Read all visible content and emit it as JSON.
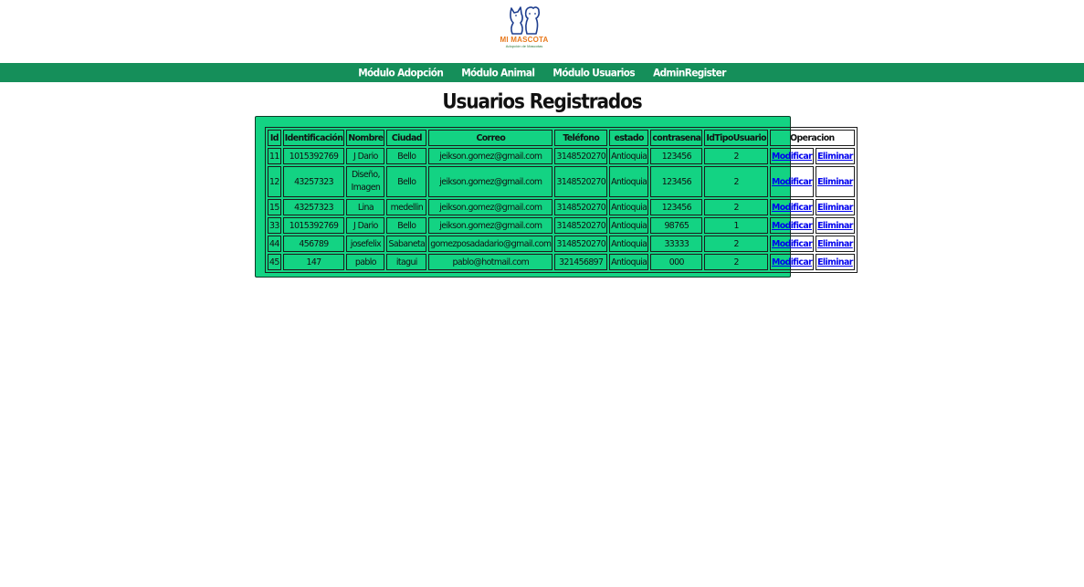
{
  "brand": {
    "name": "MI MASCOTA",
    "tagline": "Adopción de Mascotas"
  },
  "nav": {
    "items": [
      {
        "label": "Módulo Adopción"
      },
      {
        "label": "Módulo Animal"
      },
      {
        "label": "Módulo Usuarios"
      },
      {
        "label": "AdminRegister"
      }
    ]
  },
  "page": {
    "title": "Usuarios Registrados"
  },
  "table": {
    "headers": [
      "Id",
      "Identificación",
      "Nombre",
      "Ciudad",
      "Correo",
      "Teléfono",
      "estado",
      "contrasena",
      "IdTipoUsuario",
      "Operacion"
    ],
    "rows": [
      {
        "id": "11",
        "identificacion": "1015392769",
        "nombre": "J Dario",
        "ciudad": "Bello",
        "correo": "jeikson.gomez@gmail.com",
        "telefono": "3148520270",
        "estado": "Antioquia",
        "contrasena": "123456",
        "tipo": "2"
      },
      {
        "id": "12",
        "identificacion": "43257323",
        "nombre": "Diseño, Imagen",
        "ciudad": "Bello",
        "correo": "jeikson.gomez@gmail.com",
        "telefono": "3148520270",
        "estado": "Antioquia",
        "contrasena": "123456",
        "tipo": "2"
      },
      {
        "id": "15",
        "identificacion": "43257323",
        "nombre": "Lina",
        "ciudad": "medellin",
        "correo": "jeikson.gomez@gmail.com",
        "telefono": "3148520270",
        "estado": "Antioquia",
        "contrasena": "123456",
        "tipo": "2"
      },
      {
        "id": "33",
        "identificacion": "1015392769",
        "nombre": "J Dario",
        "ciudad": "Bello",
        "correo": "jeikson.gomez@gmail.com",
        "telefono": "3148520270",
        "estado": "Antioquia",
        "contrasena": "98765",
        "tipo": "1"
      },
      {
        "id": "44",
        "identificacion": "456789",
        "nombre": "josefelix",
        "ciudad": "Sabaneta",
        "correo": "gomezposadadario@gmail.com",
        "telefono": "3148520270",
        "estado": "Antioquia",
        "contrasena": "33333",
        "tipo": "2"
      },
      {
        "id": "45",
        "identificacion": "147",
        "nombre": "pablo",
        "ciudad": "itagui",
        "correo": "pablo@hotmail.com",
        "telefono": "321456897",
        "estado": "Antioquia",
        "contrasena": "000",
        "tipo": "2"
      }
    ],
    "actions": {
      "modify_label": "Modificar",
      "delete_label": "Eliminar"
    }
  },
  "colors": {
    "nav_bg": "#158f5a",
    "panel_bg": "#13d383",
    "link": "#0000ee",
    "brand_orange": "#e8791d",
    "brand_blue": "#1f3f8f"
  },
  "icons": {
    "logo": "cat-and-dog-logo-icon"
  }
}
